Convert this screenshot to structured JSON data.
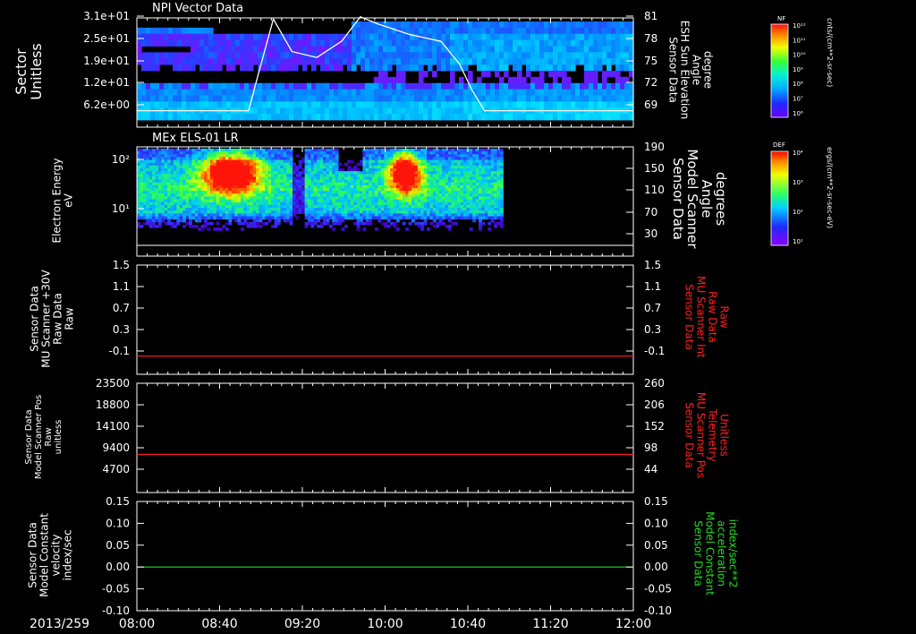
{
  "date_label": "2013/259",
  "time_ticks": [
    "08:00",
    "08:40",
    "09:20",
    "10:00",
    "10:40",
    "11:20",
    "12:00"
  ],
  "colorbars": [
    {
      "label": "NF",
      "unit": "cnts/(cm**2-sr-sec)",
      "ticks": [
        "10¹²",
        "10¹¹",
        "10¹⁰",
        "10⁹",
        "10⁸",
        "10⁷",
        "10⁶"
      ]
    },
    {
      "label": "DEF",
      "unit": "ergs/(cm**2-sr-sec-eV)",
      "ticks": [
        "10⁴",
        "10³",
        "10²",
        "10¹"
      ]
    }
  ],
  "chart_data": [
    {
      "type": "heatmap",
      "title": "NPI Vector Data",
      "ylabel": [
        "Sector",
        "Unitless"
      ],
      "yticks": [
        "3.1e+01",
        "2.5e+01",
        "1.9e+01",
        "1.2e+01",
        "6.2e+00"
      ],
      "y2label": [
        "Sensor Data",
        "ESH Sun Elevation",
        "Angle",
        "degree"
      ],
      "y2ticks": [
        "81",
        "78",
        "75",
        "72",
        "69"
      ],
      "overlay_line": {
        "name": "ESH Sun Elevation Angle",
        "color": "#ffffff",
        "x_hours": [
          8.0,
          8.9,
          9.0,
          9.1,
          9.25,
          9.45,
          9.65,
          9.8,
          9.95,
          10.2,
          10.45,
          10.6,
          10.7,
          10.8,
          12.0
        ],
        "y": [
          68.2,
          68.2,
          74.5,
          80.6,
          76.2,
          75.4,
          77.6,
          80.9,
          79.9,
          78.5,
          77.6,
          74.5,
          71.0,
          68.2,
          68.2
        ]
      }
    },
    {
      "type": "heatmap",
      "title": "MEx ELS-01 LR",
      "ylabel": [
        "Electron Energy",
        "eV"
      ],
      "yticks": [
        "10²",
        "10¹"
      ],
      "y2label": [
        "Sensor Data",
        "Model Scanner",
        "Angle",
        "degrees"
      ],
      "y2ticks": [
        "190",
        "150",
        "110",
        "70",
        "30"
      ],
      "overlay_line": {
        "name": "Model Scanner Angle",
        "color": "#ffffff",
        "y": 10
      }
    },
    {
      "type": "line",
      "ylabel": [
        "Sensor Data",
        "MU Scanner +30V",
        "Raw Data",
        "Raw"
      ],
      "yticks": [
        "1.5",
        "1.1",
        "0.7",
        "0.3",
        "-0.1"
      ],
      "y2label": [
        "Sensor Data",
        "MU Scanner Int",
        "Raw Data",
        "Raw"
      ],
      "y2ticks": [
        "1.5",
        "1.1",
        "0.7",
        "0.3",
        "-0.1"
      ],
      "ylim": [
        -0.3,
        1.5
      ],
      "series": [
        {
          "color": "#ff2020",
          "y": 0.0
        }
      ]
    },
    {
      "type": "line",
      "ylabel": [
        "Sensor Data",
        "Model Scanner Pos",
        "Raw",
        "unitless"
      ],
      "yticks": [
        "23500",
        "18800",
        "14100",
        "9400",
        "4700"
      ],
      "y2label": [
        "Sensor Data",
        "MU Scanner Pos",
        "Telemetry",
        "Unitless"
      ],
      "y2ticks": [
        "260",
        "206",
        "152",
        "98",
        "44"
      ],
      "ylim": [
        0,
        23500
      ],
      "series": [
        {
          "color": "#ff2020",
          "y": 8200
        }
      ]
    },
    {
      "type": "line",
      "ylabel": [
        "Sensor Data",
        "Model Constant",
        "velocity",
        "index/sec"
      ],
      "yticks": [
        "0.15",
        "0.10",
        "0.05",
        "0.00",
        "-0.05",
        "-0.10"
      ],
      "y2label": [
        "Sensor Data",
        "Model Constant",
        "acceleration",
        "index/sec**2"
      ],
      "y2ticks": [
        "0.15",
        "0.10",
        "0.05",
        "0.00",
        "-0.05",
        "-0.10"
      ],
      "ylim": [
        -0.1,
        0.15
      ],
      "series": [
        {
          "color": "#22dd22",
          "y": 0.0
        }
      ]
    }
  ]
}
